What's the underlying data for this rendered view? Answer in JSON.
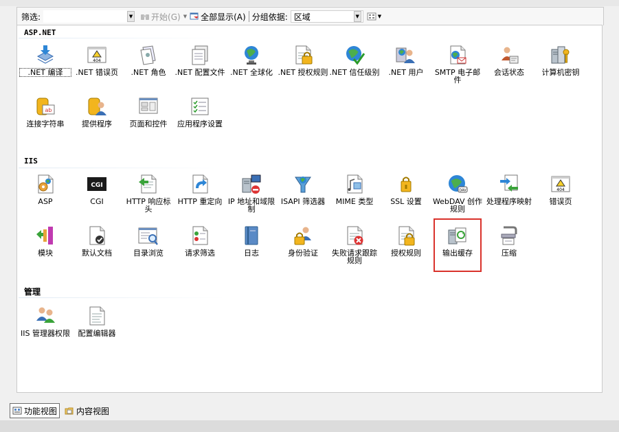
{
  "toolbar": {
    "filter_label": "筛选:",
    "filter_value": "",
    "start_label": "开始(G)",
    "show_all_label": "全部显示(A)",
    "group_by_label": "分组依据:",
    "group_by_value": "区域"
  },
  "sections": {
    "aspnet": {
      "title": "ASP.NET",
      "items": [
        {
          "label": ".NET 编译",
          "icon": "download-arrow-icon"
        },
        {
          "label": ".NET 错误页",
          "icon": "error-404-icon"
        },
        {
          "label": ".NET 角色",
          "icon": "roles-documents-icon"
        },
        {
          "label": ".NET 配置文件",
          "icon": "profile-config-icon"
        },
        {
          "label": ".NET 全球化",
          "icon": "globe-icon"
        },
        {
          "label": ".NET 授权规则",
          "icon": "authorization-lock-icon"
        },
        {
          "label": ".NET 信任级别",
          "icon": "trust-globe-check-icon"
        },
        {
          "label": ".NET 用户",
          "icon": "users-icon"
        },
        {
          "label": "SMTP 电子邮件",
          "icon": "email-icon"
        },
        {
          "label": "会话状态",
          "icon": "session-user-icon"
        },
        {
          "label": "计算机密钥",
          "icon": "machine-key-icon"
        },
        {
          "label": "连接字符串",
          "icon": "connection-string-icon"
        },
        {
          "label": "提供程序",
          "icon": "providers-icon"
        },
        {
          "label": "页面和控件",
          "icon": "pages-controls-icon"
        },
        {
          "label": "应用程序设置",
          "icon": "app-settings-icon"
        }
      ]
    },
    "iis": {
      "title": "IIS",
      "items": [
        {
          "label": "ASP",
          "icon": "asp-gear-icon"
        },
        {
          "label": "CGI",
          "icon": "cgi-icon"
        },
        {
          "label": "HTTP 响应标头",
          "icon": "http-response-headers-icon"
        },
        {
          "label": "HTTP 重定向",
          "icon": "http-redirect-icon"
        },
        {
          "label": "IP 地址和域限制",
          "icon": "ip-restrictions-icon"
        },
        {
          "label": "ISAPI 筛选器",
          "icon": "isapi-filter-icon"
        },
        {
          "label": "MIME 类型",
          "icon": "mime-types-icon"
        },
        {
          "label": "SSL 设置",
          "icon": "ssl-lock-icon"
        },
        {
          "label": "WebDAV 创作规则",
          "icon": "webdav-globe-icon"
        },
        {
          "label": "处理程序映射",
          "icon": "handler-mappings-icon"
        },
        {
          "label": "错误页",
          "icon": "error-page-404-icon"
        },
        {
          "label": "模块",
          "icon": "modules-icon"
        },
        {
          "label": "默认文档",
          "icon": "default-document-icon"
        },
        {
          "label": "目录浏览",
          "icon": "directory-browsing-icon"
        },
        {
          "label": "请求筛选",
          "icon": "request-filtering-icon"
        },
        {
          "label": "日志",
          "icon": "logging-book-icon"
        },
        {
          "label": "身份验证",
          "icon": "authentication-icon"
        },
        {
          "label": "失败请求跟踪规则",
          "icon": "failed-request-tracing-icon"
        },
        {
          "label": "授权规则",
          "icon": "authorization-rules-icon"
        },
        {
          "label": "输出缓存",
          "icon": "output-caching-icon"
        },
        {
          "label": "压缩",
          "icon": "compression-clamp-icon"
        }
      ]
    },
    "management": {
      "title": "管理",
      "items": [
        {
          "label": "IIS 管理器权限",
          "icon": "iis-manager-permissions-icon"
        },
        {
          "label": "配置编辑器",
          "icon": "configuration-editor-icon"
        }
      ]
    }
  },
  "bottom": {
    "features_view_label": "功能视图",
    "content_view_label": "内容视图"
  },
  "highlight_color": "#d9312a"
}
